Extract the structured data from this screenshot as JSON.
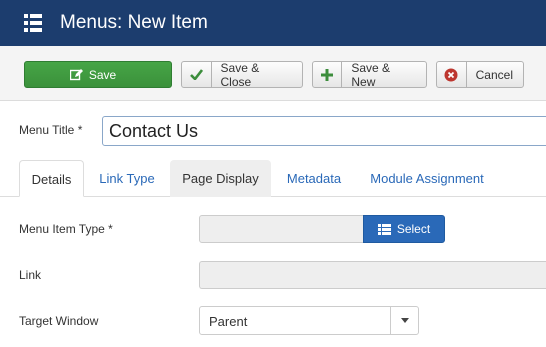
{
  "header": {
    "title": "Menus: New Item",
    "icon": "list-icon",
    "color": "#1c3d6e"
  },
  "toolbar": {
    "save_label": "Save",
    "save_close_label": "Save & Close",
    "save_new_label": "Save & New",
    "cancel_label": "Cancel",
    "save_color": "#46a546"
  },
  "form": {
    "menu_title_label": "Menu Title *",
    "menu_title_value": "Contact Us"
  },
  "tabs": [
    {
      "label": "Details",
      "state": "active"
    },
    {
      "label": "Link Type"
    },
    {
      "label": "Page Display",
      "state": "hover"
    },
    {
      "label": "Metadata"
    },
    {
      "label": "Module Assignment"
    }
  ],
  "details": {
    "menu_item_type_label": "Menu Item Type *",
    "select_label": "Select",
    "link_label": "Link",
    "target_window_label": "Target Window",
    "target_window_value": "Parent"
  }
}
